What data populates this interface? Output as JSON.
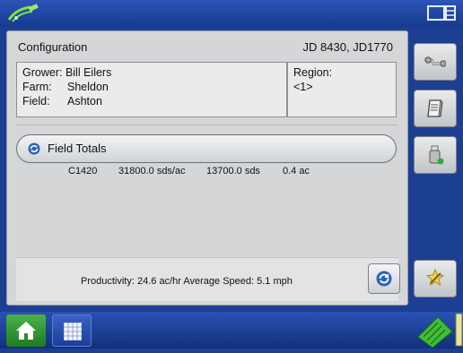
{
  "header": {
    "gps_icon": "gps-satellite-icon",
    "display_icon": "display-setup-icon"
  },
  "configuration": {
    "label": "Configuration",
    "equipment": "JD 8430, JD1770"
  },
  "grower": {
    "grower_label": "Grower:",
    "grower_value": "Bill Eilers",
    "farm_label": "Farm:",
    "farm_value": "Sheldon",
    "field_label": "Field:",
    "field_value": "Ashton"
  },
  "region": {
    "label": "Region:",
    "value": "<1>"
  },
  "field_totals": {
    "label": "Field Totals",
    "row": {
      "product": "C1420",
      "rate": "31800.0 sds/ac",
      "total": "13700.0 sds",
      "area": "0.4 ac"
    }
  },
  "status": {
    "productivity_label": "Productivity:",
    "productivity_value": "24.6 ac/hr",
    "speed_label": "Average Speed:",
    "speed_value": "5.1 mph"
  },
  "side_buttons": [
    "wrench-icon",
    "book-icon",
    "usb-drive-icon",
    "star-tool-icon"
  ],
  "bottom_bar": [
    "home-icon",
    "grid-icon",
    "field-map-icon"
  ],
  "colors": {
    "top_bar": "#2c55b8",
    "panel": "#d4d6d8",
    "home_green": "#3aa43c"
  }
}
